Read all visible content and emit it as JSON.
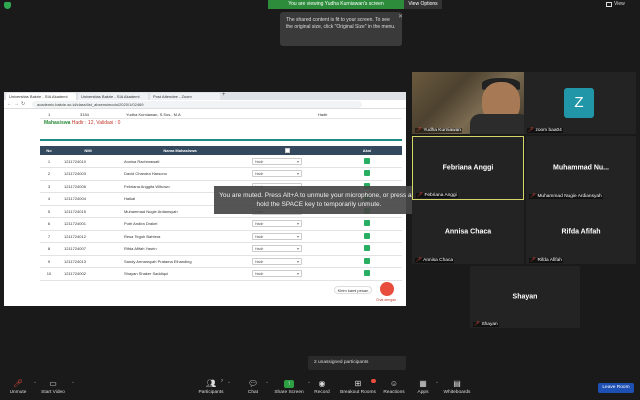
{
  "topbar": {
    "viewing_banner": "You are viewing Yudha Kurniawan's screen",
    "view_options": "View Options",
    "view_right": "View"
  },
  "fit_tooltip": {
    "text": "The shared content is fit to your screen. To see the original size, click \"Original Size\" in the menu."
  },
  "shared_screen": {
    "tabs": [
      {
        "label": "Universitas Bakrie - SIA Akademi"
      },
      {
        "label": "Universitas Bakrie - SIA Akademi"
      },
      {
        "label": "Post Attendee - Zoom"
      }
    ],
    "address": "academic.bakrie.ac.id/class/list_absensimodo/2020/1/02469",
    "top_row": {
      "no": "1",
      "code": "3154",
      "name": "Yudha Kurniawan, S.Sos., M.A",
      "status": "Hadir"
    },
    "summary": {
      "prefix": "Mahasiswa",
      "hadir": "Hadir : 12",
      "validasi": ", Validasi : 0"
    },
    "table": {
      "headers": [
        "No",
        "NIM",
        "Nama Mahasiswa",
        "",
        "Aksi"
      ],
      "rows": [
        {
          "no": "1",
          "nim": "1211724010",
          "nama": "Annisa Rachmawati",
          "status": "Hadir"
        },
        {
          "no": "2",
          "nim": "1211724003",
          "nama": "David Chandra Harsono",
          "status": "Hadir"
        },
        {
          "no": "3",
          "nim": "1211724006",
          "nama": "Febriana Anggita Wibowo",
          "status": "Hadir"
        },
        {
          "no": "4",
          "nim": "1211724004",
          "nama": "Haikal",
          "status": "Hadir"
        },
        {
          "no": "5",
          "nim": "1211724015",
          "nama": "Muhammad Nugie Ardiansyah",
          "status": "Hadir"
        },
        {
          "no": "6",
          "nim": "1211724001",
          "nama": "Putri Andira Drakel",
          "status": "Hadir"
        },
        {
          "no": "7",
          "nim": "1211724012",
          "nama": "Resa Teguh Bahtera",
          "status": "Hadir"
        },
        {
          "no": "8",
          "nim": "1211724007",
          "nama": "Rifda Afifah Yasrin",
          "status": "Hadir"
        },
        {
          "no": "9",
          "nim": "1211724013",
          "nama": "Sandy Armansyah Pratama Elhanding",
          "status": "Hadir"
        },
        {
          "no": "10",
          "nim": "1211724002",
          "nama": "Shayan Shaker Saddiqui",
          "status": "Hadir"
        }
      ]
    },
    "chat_bubble": "Kirim kami pesan",
    "chat_fab_label": "Chat dengan"
  },
  "muted_notice": "You are muted. Press Alt+A to unmute your microphone, or press and hold the SPACE key to temporarily unmute.",
  "participants": [
    {
      "tile_name": "",
      "label": "Yudha Kurniawan"
    },
    {
      "tile_name": "Z",
      "label": "zoom baa04"
    },
    {
      "tile_name": "Febriana Anggi",
      "label": "Febriana Anggi"
    },
    {
      "tile_name": "Muhammad  Nu...",
      "label": "Muhammad Nugie Ardiansyah"
    },
    {
      "tile_name": "Annisa Chaca",
      "label": "Annisa Chaca"
    },
    {
      "tile_name": "Rifda Afifah",
      "label": "Rifda Afifah"
    },
    {
      "tile_name": "Shayan",
      "label": "Shayan"
    }
  ],
  "unassigned": "2 unassigned participants",
  "toolbar": {
    "unmute": "Unmute",
    "start_video": "Start Video",
    "participants": "Participants",
    "participants_count": "7",
    "chat": "Chat",
    "share_screen": "Share Screen",
    "record": "Record",
    "breakout_rooms": "Breakout Rooms",
    "reactions": "Reactions",
    "apps": "Apps",
    "whiteboards": "Whiteboards",
    "leave_room": "Leave Room"
  },
  "colors": {
    "accent_green": "#2d8c3c",
    "leave_blue": "#1e50b4",
    "table_header": "#34495e",
    "hadir_green": "#2a8a3a",
    "validasi_red": "#c0392b"
  }
}
